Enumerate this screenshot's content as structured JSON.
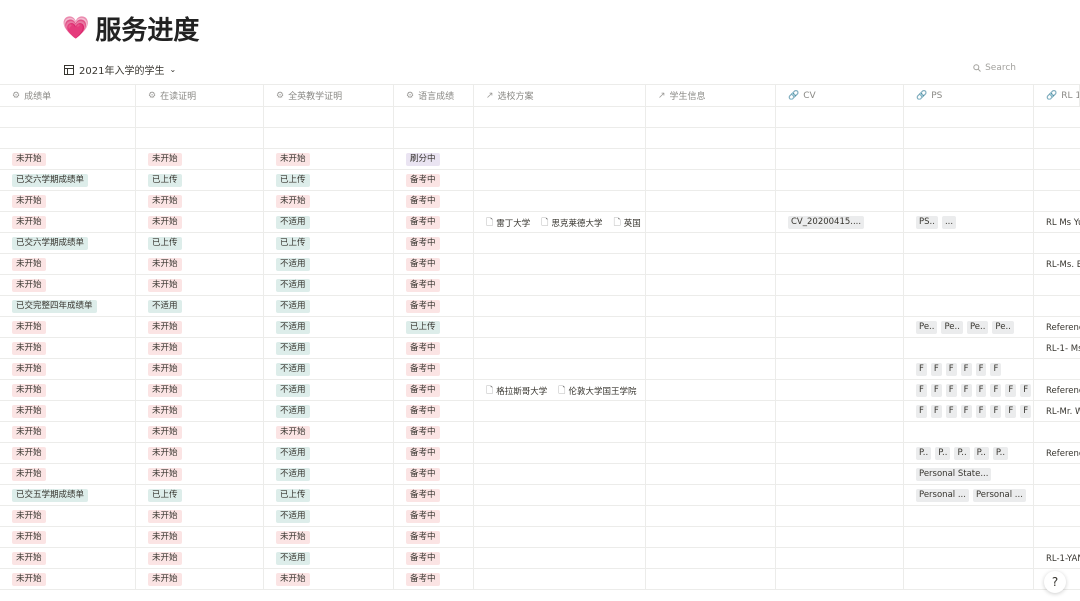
{
  "title": {
    "emoji": "💗",
    "text": "服务进度"
  },
  "view": {
    "label": "2021年入学的学生",
    "search_label": "Search"
  },
  "columns": [
    {
      "label": "成绩单",
      "icon": "⚙"
    },
    {
      "label": "在读证明",
      "icon": "⚙"
    },
    {
      "label": "全英教学证明",
      "icon": "⚙"
    },
    {
      "label": "语言成绩",
      "icon": "⚙"
    },
    {
      "label": "选校方案",
      "icon": "↗"
    },
    {
      "label": "学生信息",
      "icon": "↗"
    },
    {
      "label": "CV",
      "icon": "🔗"
    },
    {
      "label": "PS",
      "icon": "🔗"
    },
    {
      "label": "RL 1",
      "icon": "🔗"
    }
  ],
  "rows": [
    {
      "c1": "",
      "c2": "",
      "c3": "",
      "c4": ""
    },
    {
      "c1": "",
      "c2": "",
      "c3": "",
      "c4": ""
    },
    {
      "c1": "未开始",
      "c2": "未开始",
      "c3": "未开始",
      "c4": "刷分中"
    },
    {
      "c1": "已交六学期成绩单",
      "c2": "已上传",
      "c3": "已上传",
      "c4": "备考中"
    },
    {
      "c1": "未开始",
      "c2": "未开始",
      "c3": "未开始",
      "c4": "备考中"
    },
    {
      "c1": "未开始",
      "c2": "未开始",
      "c3": "不适用",
      "c4": "备考中",
      "schools": [
        "雷丁大学",
        "思克莱德大学",
        "英国"
      ],
      "cv": "CV_20200415....",
      "ps": [
        "PS..",
        "..."
      ],
      "rl": "RL Ms Yu"
    },
    {
      "c1": "已交六学期成绩单",
      "c2": "已上传",
      "c3": "已上传",
      "c4": "备考中"
    },
    {
      "c1": "未开始",
      "c2": "未开始",
      "c3": "不适用",
      "c4": "备考中",
      "rl": "RL-Ms. B"
    },
    {
      "c1": "未开始",
      "c2": "未开始",
      "c3": "不适用",
      "c4": "备考中"
    },
    {
      "c1": "已交完整四年成绩单",
      "c2": "不适用",
      "c3": "不适用",
      "c4": "备考中"
    },
    {
      "c1": "未开始",
      "c2": "未开始",
      "c3": "不适用",
      "c4": "已上传",
      "ps": [
        "Pe..",
        "Pe..",
        "Pe..",
        "Pe.."
      ],
      "rl": "Referenc"
    },
    {
      "c1": "未开始",
      "c2": "未开始",
      "c3": "不适用",
      "c4": "备考中",
      "rl": "RL-1- Ms."
    },
    {
      "c1": "未开始",
      "c2": "未开始",
      "c3": "不适用",
      "c4": "备考中",
      "ps": [
        "F",
        "F",
        "F",
        "F",
        "F",
        "F"
      ]
    },
    {
      "c1": "未开始",
      "c2": "未开始",
      "c3": "不适用",
      "c4": "备考中",
      "schools": [
        "格拉斯哥大学",
        "伦敦大学国王学院"
      ],
      "ps": [
        "F",
        "F",
        "F",
        "F",
        "F",
        "F",
        "F",
        "F"
      ],
      "rl": "Reference"
    },
    {
      "c1": "未开始",
      "c2": "未开始",
      "c3": "不适用",
      "c4": "备考中",
      "ps": [
        "F",
        "F",
        "F",
        "F",
        "F",
        "F",
        "F",
        "F"
      ],
      "rl": "RL-Mr. W"
    },
    {
      "c1": "未开始",
      "c2": "未开始",
      "c3": "未开始",
      "c4": "备考中"
    },
    {
      "c1": "未开始",
      "c2": "未开始",
      "c3": "不适用",
      "c4": "备考中",
      "ps": [
        "P..",
        "P..",
        "P..",
        "P..",
        "P.."
      ],
      "rl": "Referenc"
    },
    {
      "c1": "未开始",
      "c2": "未开始",
      "c3": "不适用",
      "c4": "备考中",
      "ps": [
        "Personal State..."
      ]
    },
    {
      "c1": "已交五学期成绩单",
      "c2": "已上传",
      "c3": "已上传",
      "c4": "备考中",
      "ps": [
        "Personal ...",
        "Personal ..."
      ]
    },
    {
      "c1": "未开始",
      "c2": "未开始",
      "c3": "不适用",
      "c4": "备考中"
    },
    {
      "c1": "未开始",
      "c2": "未开始",
      "c3": "未开始",
      "c4": "备考中"
    },
    {
      "c1": "未开始",
      "c2": "未开始",
      "c3": "不适用",
      "c4": "备考中",
      "rl": "RL-1-YAN"
    },
    {
      "c1": "未开始",
      "c2": "未开始",
      "c3": "未开始",
      "c4": "备考中"
    }
  ],
  "colors": {
    "red_tag": "#fbe4e4",
    "green_tag": "#ddedea",
    "purple_tag": "#eae4f2",
    "gray_chip": "#ebeced"
  },
  "help": "?"
}
